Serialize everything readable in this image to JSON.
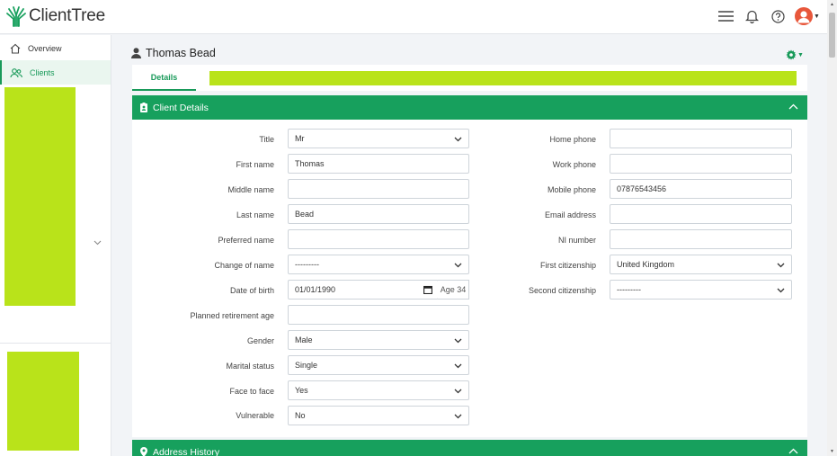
{
  "app": {
    "name": "ClientTree",
    "brand_color": "#17a05d",
    "redaction_color": "#b9e31a"
  },
  "topbar": {
    "icons": [
      "menu-icon",
      "bell-icon",
      "help-icon",
      "user-avatar-icon"
    ]
  },
  "sidebar": {
    "items": [
      {
        "label": "Overview",
        "icon": "home-icon",
        "active": false
      },
      {
        "label": "Clients",
        "icon": "users-icon",
        "active": true
      }
    ]
  },
  "client": {
    "name": "Thomas Bead"
  },
  "tabs": [
    {
      "label": "Details",
      "active": true
    }
  ],
  "client_details": {
    "header": "Client Details",
    "left": {
      "title": {
        "label": "Title",
        "value": "Mr"
      },
      "first_name": {
        "label": "First name",
        "value": "Thomas"
      },
      "middle_name": {
        "label": "Middle name",
        "value": ""
      },
      "last_name": {
        "label": "Last name",
        "value": "Bead"
      },
      "preferred_name": {
        "label": "Preferred name",
        "value": ""
      },
      "change_of_name": {
        "label": "Change of name",
        "value": "---------"
      },
      "date_of_birth": {
        "label": "Date of birth",
        "value": "01/01/1990",
        "age": "Age 34"
      },
      "planned_retirement_age": {
        "label": "Planned retirement age",
        "value": ""
      },
      "gender": {
        "label": "Gender",
        "value": "Male"
      },
      "marital_status": {
        "label": "Marital status",
        "value": "Single"
      },
      "face_to_face": {
        "label": "Face to face",
        "value": "Yes"
      },
      "vulnerable": {
        "label": "Vulnerable",
        "value": "No"
      }
    },
    "right": {
      "home_phone": {
        "label": "Home phone",
        "value": ""
      },
      "work_phone": {
        "label": "Work phone",
        "value": ""
      },
      "mobile_phone": {
        "label": "Mobile phone",
        "value": "07876543456"
      },
      "email_address": {
        "label": "Email address",
        "value": ""
      },
      "ni_number": {
        "label": "NI number",
        "value": ""
      },
      "first_citizenship": {
        "label": "First citizenship",
        "value": "United Kingdom"
      },
      "second_citizenship": {
        "label": "Second citizenship",
        "value": "---------"
      }
    }
  },
  "address_history": {
    "header": "Address History"
  }
}
